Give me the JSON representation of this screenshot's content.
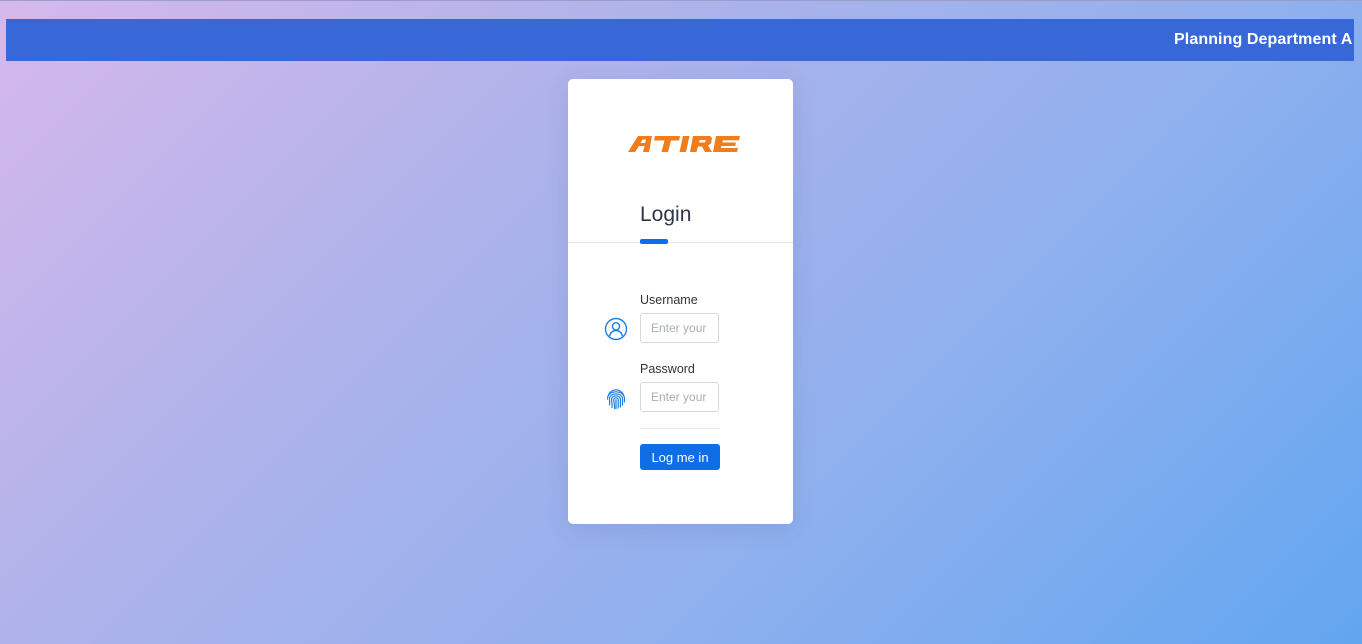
{
  "header": {
    "marquee_text": "Planning Department   A"
  },
  "login": {
    "logo_text": "ATIRE",
    "title": "Login",
    "username": {
      "label": "Username",
      "placeholder": "Enter your",
      "icon": "user-circle-icon"
    },
    "password": {
      "label": "Password",
      "placeholder": "Enter your",
      "icon": "fingerprint-icon"
    },
    "submit_label": "Log me in"
  },
  "colors": {
    "header_bar": "#3868d8",
    "accent": "#0d6ee8",
    "logo": "#f07d1a",
    "background_start": "#d6b8ec",
    "background_end": "#62a6f0"
  }
}
